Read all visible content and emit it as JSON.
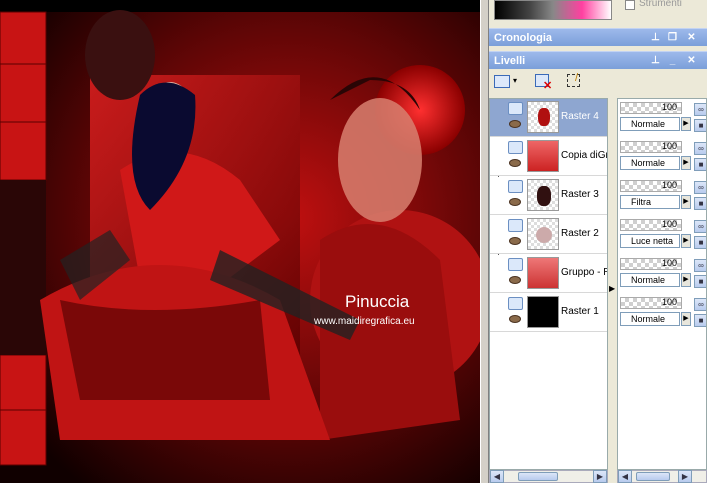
{
  "panels": {
    "cronologia": {
      "title": "Cronologia"
    },
    "livelli": {
      "title": "Livelli"
    },
    "strumenti_label": "Strumenti"
  },
  "watermark": {
    "name": "Pinuccia",
    "url": "www.maidiregrafica.eu"
  },
  "layers": [
    {
      "name": "Raster 4",
      "opacity": "100",
      "blend": "Normale",
      "selected": true
    },
    {
      "name": "Copia diGru",
      "opacity": "100",
      "blend": "Normale",
      "selected": false
    },
    {
      "name": "Raster 3",
      "opacity": "100",
      "blend": "Filtra",
      "selected": false
    },
    {
      "name": "Raster 2",
      "opacity": "100",
      "blend": "Luce netta",
      "selected": false
    },
    {
      "name": "Gruppo - Ra",
      "opacity": "100",
      "blend": "Normale",
      "selected": false
    },
    {
      "name": "Raster 1",
      "opacity": "100",
      "blend": "Normale",
      "selected": false
    }
  ]
}
